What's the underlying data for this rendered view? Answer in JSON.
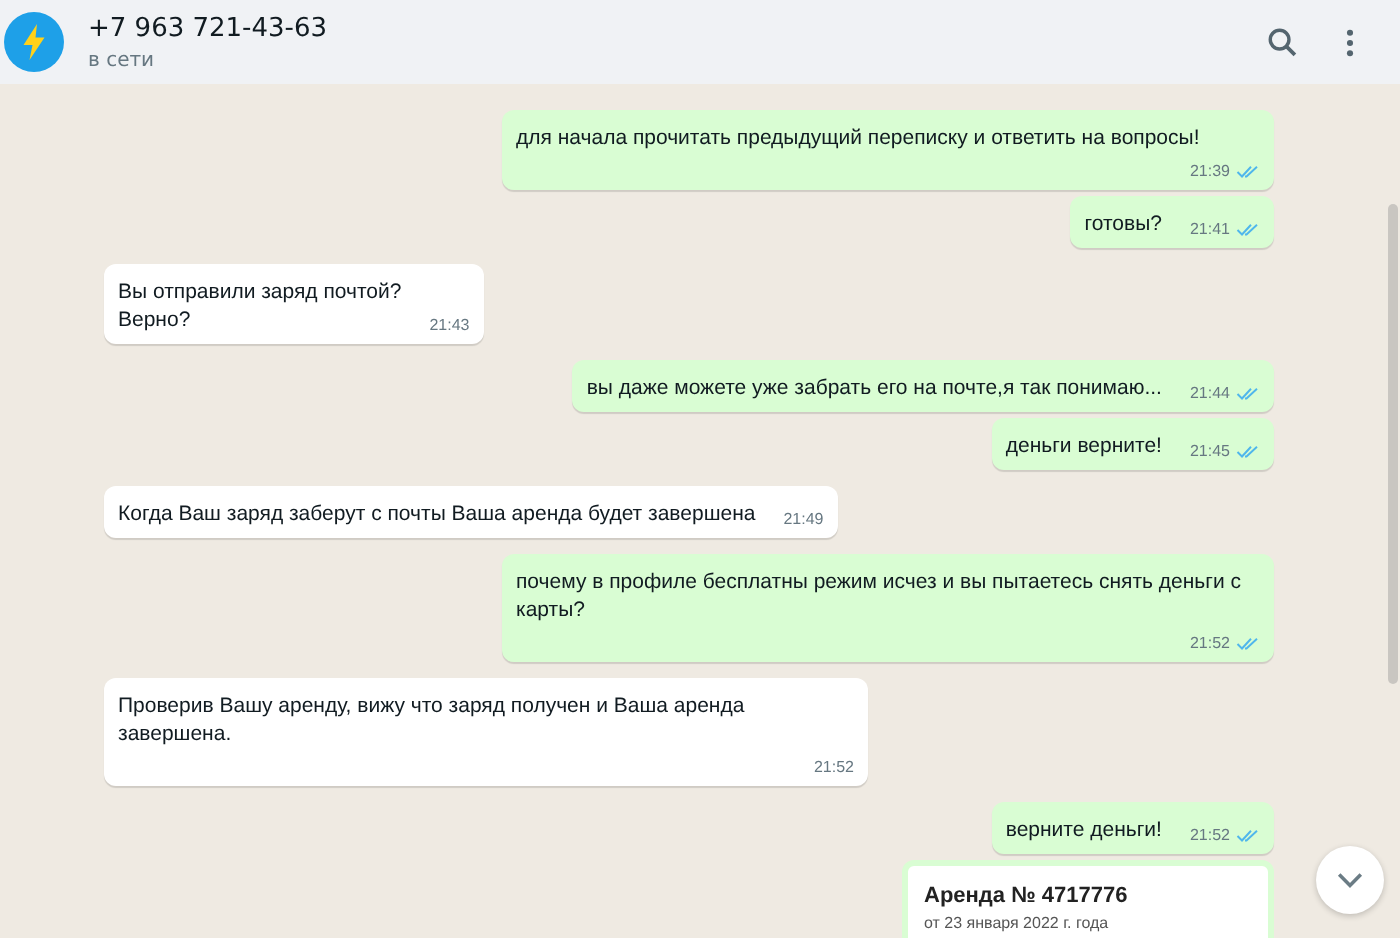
{
  "header": {
    "title": "+7 963 721-43-63",
    "status": "в сети"
  },
  "messages": [
    {
      "kind": "out",
      "text": "для начала прочитать предыдущий переписку и ответить на вопросы!",
      "time": "21:39",
      "read": true
    },
    {
      "kind": "out",
      "text": "готовы?",
      "time": "21:41",
      "read": true
    },
    {
      "kind": "in",
      "text": "Вы отправили заряд почтой?\nВерно?",
      "time": "21:43"
    },
    {
      "kind": "out",
      "text": "вы даже можете уже забрать его на почте,я так понимаю...",
      "time": "21:44",
      "read": true
    },
    {
      "kind": "out",
      "text": "деньги верните!",
      "time": "21:45",
      "read": true
    },
    {
      "kind": "in",
      "text": "Когда Ваш заряд заберут с почты Ваша аренда будет завершена",
      "time": "21:49"
    },
    {
      "kind": "out",
      "text": "почему в профиле бесплатны режим исчез и вы пытаетесь снять деньги с карты?",
      "time": "21:52",
      "read": true
    },
    {
      "kind": "in",
      "text": "Проверив Вашу аренду, вижу что заряд получен и Ваша аренда завершена.",
      "time": "21:52"
    },
    {
      "kind": "out",
      "text": "верните деньги!",
      "time": "21:52",
      "read": true
    },
    {
      "kind": "card",
      "title": "Аренда № 4717776",
      "subtitle": "от 23 января 2022 г. года"
    }
  ]
}
